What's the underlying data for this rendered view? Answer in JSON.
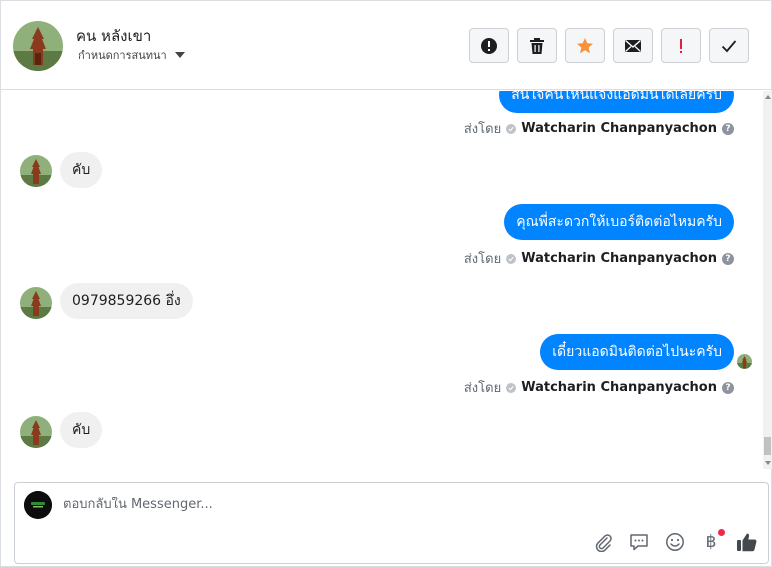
{
  "header": {
    "contact_name": "คน หลังเขา",
    "contact_subtitle": "กำหนดการสนทนา",
    "toolbar": [
      {
        "name": "spam-button",
        "icon": "alert-circle-icon"
      },
      {
        "name": "delete-button",
        "icon": "trash-icon"
      },
      {
        "name": "star-button",
        "icon": "star-icon",
        "color": "#f7923b"
      },
      {
        "name": "mark-unread-button",
        "icon": "envelope-icon"
      },
      {
        "name": "important-button",
        "icon": "exclamation-icon",
        "color": "#e41e3f"
      },
      {
        "name": "done-button",
        "icon": "check-icon"
      }
    ]
  },
  "messages": [
    {
      "direction": "out",
      "text": "สนใจคนไหนแจ้งแอดมินได้เลยครับ",
      "sent_by_label": "ส่งโดย",
      "sender": "Watcharin Chanpanyachon"
    },
    {
      "direction": "in",
      "text": "คับ"
    },
    {
      "direction": "out",
      "text": "คุณพี่สะดวกให้เบอร์ติดต่อไหมครับ",
      "sent_by_label": "ส่งโดย",
      "sender": "Watcharin Chanpanyachon"
    },
    {
      "direction": "in",
      "text": "0979859266 อึ่ง"
    },
    {
      "direction": "out",
      "text": "เดี๋ยวแอดมินติดต่อไปนะครับ",
      "sent_by_label": "ส่งโดย",
      "sender": "Watcharin Chanpanyachon"
    },
    {
      "direction": "in",
      "text": "คับ"
    }
  ],
  "composer": {
    "placeholder": "ตอบกลับใน Messenger...",
    "tools": [
      "paperclip-icon",
      "chat-bubble-icon",
      "smiley-icon",
      "baht-icon",
      "thumbs-up-icon"
    ],
    "baht_symbol": "฿"
  },
  "colors": {
    "outgoing_bubble": "#0084ff",
    "incoming_bubble": "#f0f0f0",
    "like_icon": "#444950"
  }
}
